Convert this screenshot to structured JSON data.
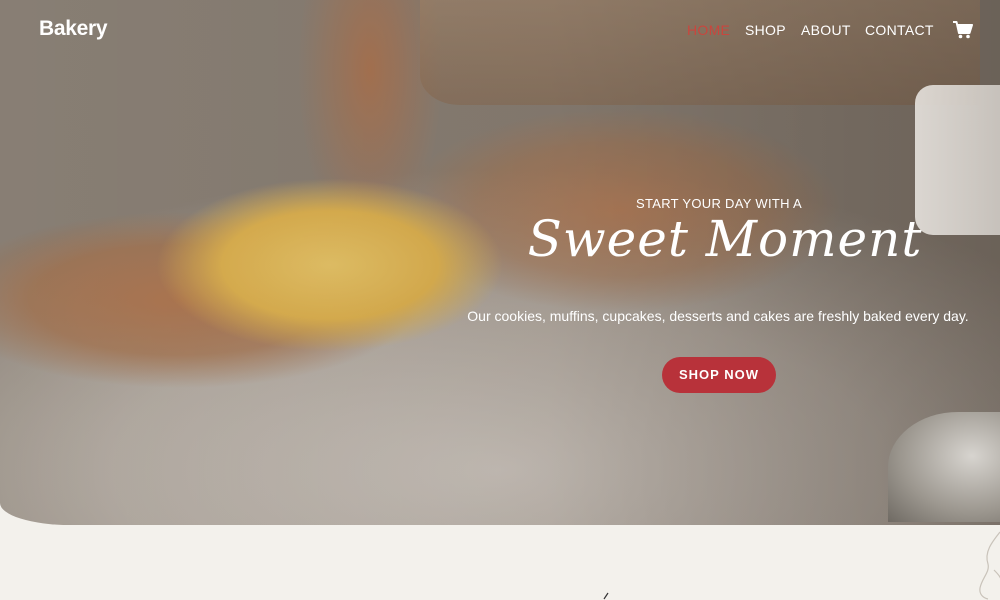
{
  "brand": {
    "name": "Bakery"
  },
  "nav": {
    "items": [
      {
        "label": "HOME",
        "active": true
      },
      {
        "label": "SHOP",
        "active": false
      },
      {
        "label": "ABOUT",
        "active": false
      },
      {
        "label": "CONTACT",
        "active": false
      }
    ],
    "cart_icon": "shopping-cart-icon"
  },
  "hero": {
    "subheading": "START YOUR DAY WITH A",
    "headline": "Sweet Moment",
    "description": "Our cookies, muffins, cupcakes, desserts and cakes are freshly baked every day.",
    "cta_label": "SHOP NOW"
  },
  "colors": {
    "accent": "#b8323a",
    "nav_active": "#c9463e",
    "page_background": "#f3f1ec",
    "text_on_hero": "#ffffff"
  }
}
